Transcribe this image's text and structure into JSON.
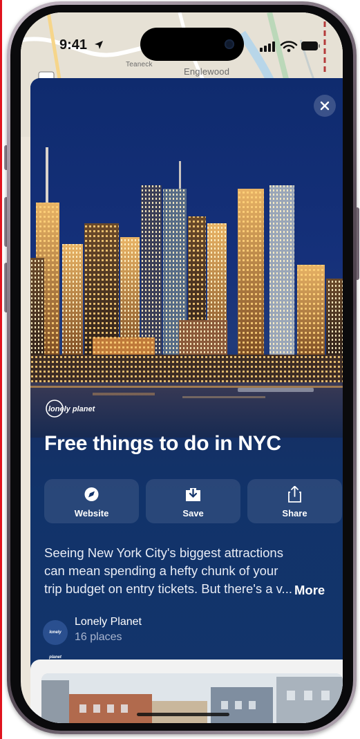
{
  "status_bar": {
    "time": "9:41"
  },
  "map": {
    "label_englewood": "Englewood",
    "label_teaneck": "Teaneck"
  },
  "guide": {
    "publisher_logo_text": "lonely planet",
    "title": "Free things to do in NYC",
    "actions": [
      {
        "label": "Website",
        "icon": "compass-icon"
      },
      {
        "label": "Save",
        "icon": "save-download-icon"
      },
      {
        "label": "Share",
        "icon": "share-icon"
      }
    ],
    "description": "Seeing New York City's biggest attractions can mean spending a hefty chunk of your trip budget on entry tickets. But there's a v...",
    "more_label": "More",
    "source": {
      "name": "Lonely Planet",
      "count": "16 places",
      "avatar_text": "lonely planet"
    }
  },
  "colors": {
    "sheet_background": "#13346b",
    "accent_white": "#ffffff"
  }
}
